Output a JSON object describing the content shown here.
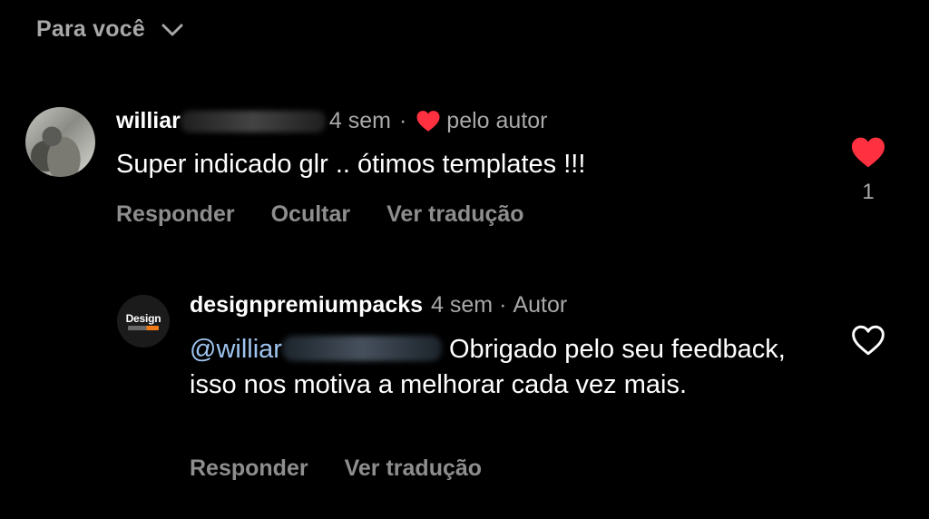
{
  "header": {
    "filter_label": "Para você",
    "chevron_icon": "chevron-down-icon"
  },
  "comments": [
    {
      "username_visible": "williar",
      "time": "4 sem",
      "separator": "·",
      "liked_by_author_label": "pelo autor",
      "text": "Super indicado glr .. ótimos templates !!!",
      "actions": [
        "Responder",
        "Ocultar",
        "Ver tradução"
      ],
      "like_count": "1",
      "liked": true,
      "heart_color": "#ff3040"
    }
  ],
  "reply": {
    "username": "designpremiumpacks",
    "time": "4 sem",
    "separator": "·",
    "role": "Autor",
    "avatar_text": "Design",
    "mention_visible": "@williar",
    "text": "Obrigado pelo seu feedback, isso nos motiva a melhorar cada vez mais.",
    "actions": [
      "Responder",
      "Ver tradução"
    ],
    "liked": false
  },
  "colors": {
    "background": "#000000",
    "muted_text": "#a8a8a8",
    "action_text": "#8e8e8e",
    "mention": "#9fc4ef",
    "like_red": "#ff3040"
  }
}
